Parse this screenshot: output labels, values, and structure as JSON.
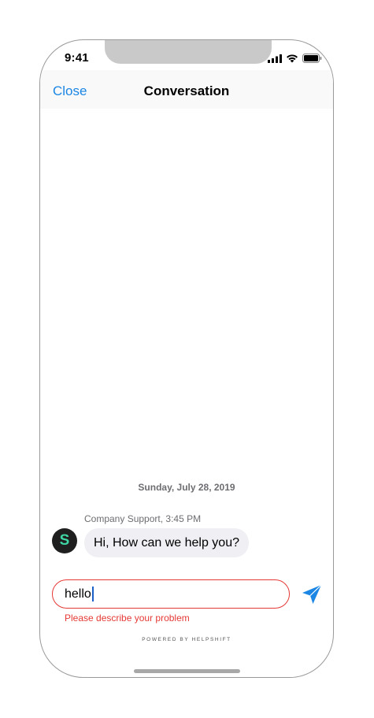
{
  "status_bar": {
    "time": "9:41",
    "icons": [
      "signal-icon",
      "wifi-icon",
      "battery-icon"
    ]
  },
  "navbar": {
    "close_label": "Close",
    "title": "Conversation"
  },
  "conversation": {
    "date_separator": "Sunday, July 28, 2019",
    "messages": [
      {
        "sender_meta": "Company Support, 3:45 PM",
        "avatar_letter": "S",
        "text": "Hi, How can we help you?"
      }
    ]
  },
  "composer": {
    "value": "hello",
    "error": "Please describe your problem",
    "send_icon": "send-icon"
  },
  "footer": {
    "powered_by": "POWERED BY HELPSHIFT"
  },
  "colors": {
    "accent": "#1b86e4",
    "error": "#e53935",
    "bubble": "#efeff4",
    "avatar_bg": "#1f1f1f",
    "avatar_fg": "#3fd6a5"
  }
}
